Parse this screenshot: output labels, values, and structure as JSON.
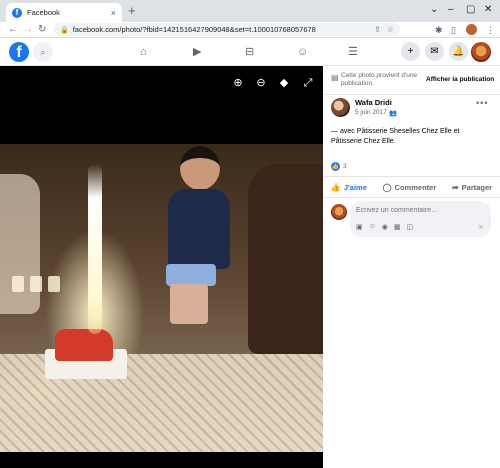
{
  "browser": {
    "tab_title": "Facebook",
    "tab_close": "×",
    "new_tab": "+",
    "window_controls": [
      "⌄",
      "–",
      "▢",
      "✕"
    ],
    "nav": {
      "back": "←",
      "forward": "→",
      "reload": "↻"
    },
    "url": "facebook.com/photo/?fbid=1421516427909048&set=t.100010768057678",
    "toolbar_icons": [
      "share-icon",
      "star-icon",
      "extensions-icon",
      "sidebar-icon",
      "profile-icon",
      "menu-icon"
    ]
  },
  "fb_nav": {
    "logo": "f",
    "center_icons": [
      "home-icon",
      "video-icon",
      "marketplace-icon",
      "groups-icon",
      "menu-lines-icon"
    ],
    "right_buttons": [
      "plus-icon",
      "messenger-icon",
      "bell-icon"
    ]
  },
  "viewer": {
    "icons": [
      "zoom-in-icon",
      "zoom-out-icon",
      "tag-icon",
      "fullscreen-icon"
    ]
  },
  "panel": {
    "notice_text": "Cette photo provient d'une publication.",
    "notice_link": "Afficher la publication",
    "author": "Wafa Dridi",
    "date": "5 juin 2017 ·",
    "caption_prefix": "— avec ",
    "caption_link1": "Pâtisserie Sheselles Chez Elle",
    "caption_mid": " et ",
    "caption_link2": "Pâtisserie Chez Elle",
    "caption_suffix": ".",
    "reaction_count": "3",
    "actions": {
      "like": "J'aime",
      "comment": "Commenter",
      "share": "Partager"
    },
    "comment_placeholder": "Écrivez un commentaire…"
  },
  "colors": {
    "fb_blue": "#1877f2",
    "chrome_tab_bg": "#dee1e6",
    "viewer_bg": "#000000"
  }
}
